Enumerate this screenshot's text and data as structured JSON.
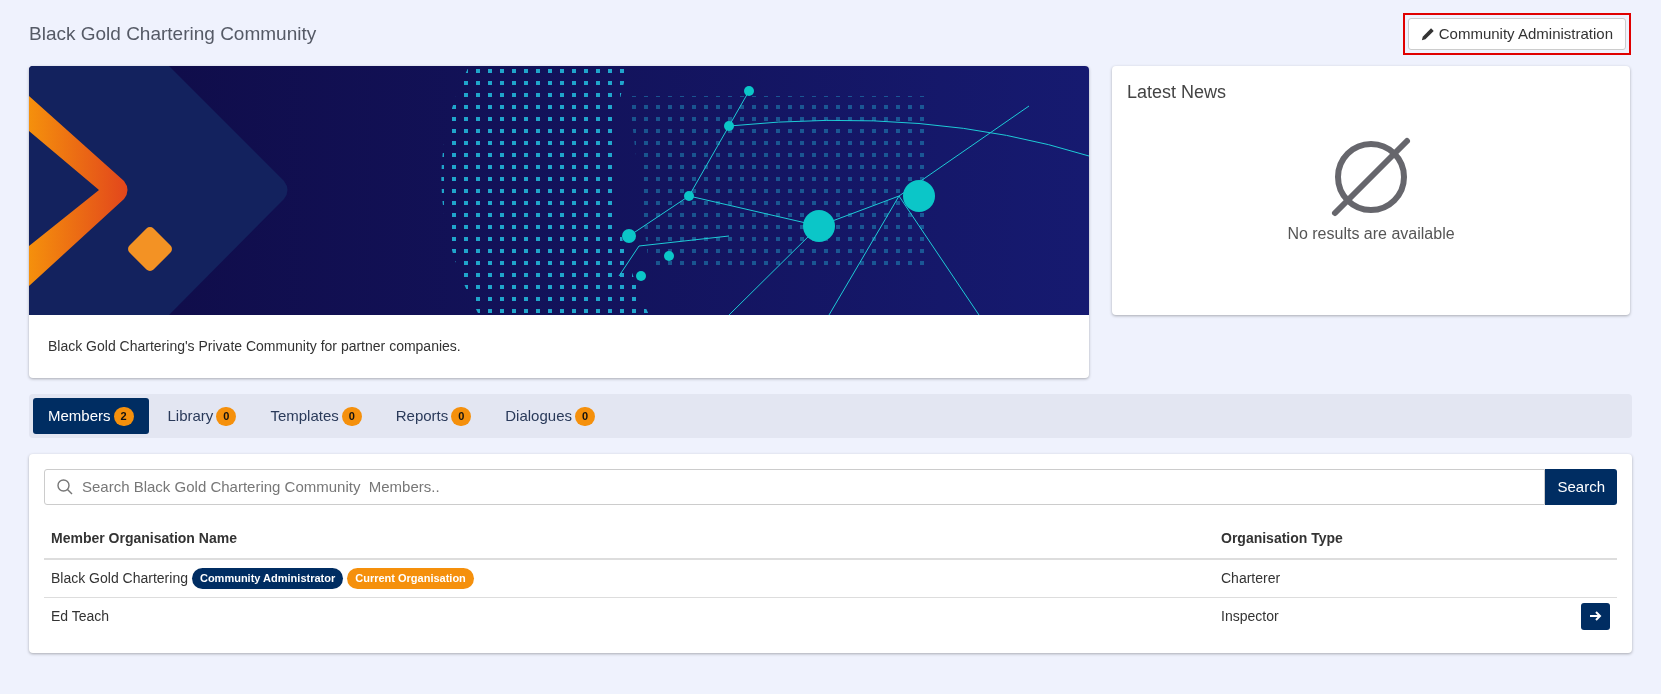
{
  "page_title": "Black Gold Chartering Community",
  "admin_button": {
    "label": "Community Administration",
    "highlighted": true
  },
  "banner": {
    "caption": "Black Gold Chartering's Private Community for partner companies."
  },
  "news": {
    "title": "Latest News",
    "empty_message": "No results are available"
  },
  "tabs": [
    {
      "label": "Members",
      "count": "2",
      "selected": true
    },
    {
      "label": "Library",
      "count": "0",
      "selected": false
    },
    {
      "label": "Templates",
      "count": "0",
      "selected": false
    },
    {
      "label": "Reports",
      "count": "0",
      "selected": false
    },
    {
      "label": "Dialogues",
      "count": "0",
      "selected": false
    }
  ],
  "search": {
    "placeholder": "Search Black Gold Chartering Community  Members..",
    "button": "Search"
  },
  "table": {
    "columns": [
      "Member Organisation Name",
      "Organisation Type"
    ],
    "rows": [
      {
        "name": "Black Gold Chartering",
        "badges": [
          {
            "label": "Community Administrator",
            "color": "#002d62"
          },
          {
            "label": "Current Organisation",
            "color": "#f5900c"
          }
        ],
        "type": "Charterer",
        "open_button": false
      },
      {
        "name": "Ed Teach",
        "badges": [],
        "type": "Inspector",
        "open_button": true
      }
    ]
  }
}
